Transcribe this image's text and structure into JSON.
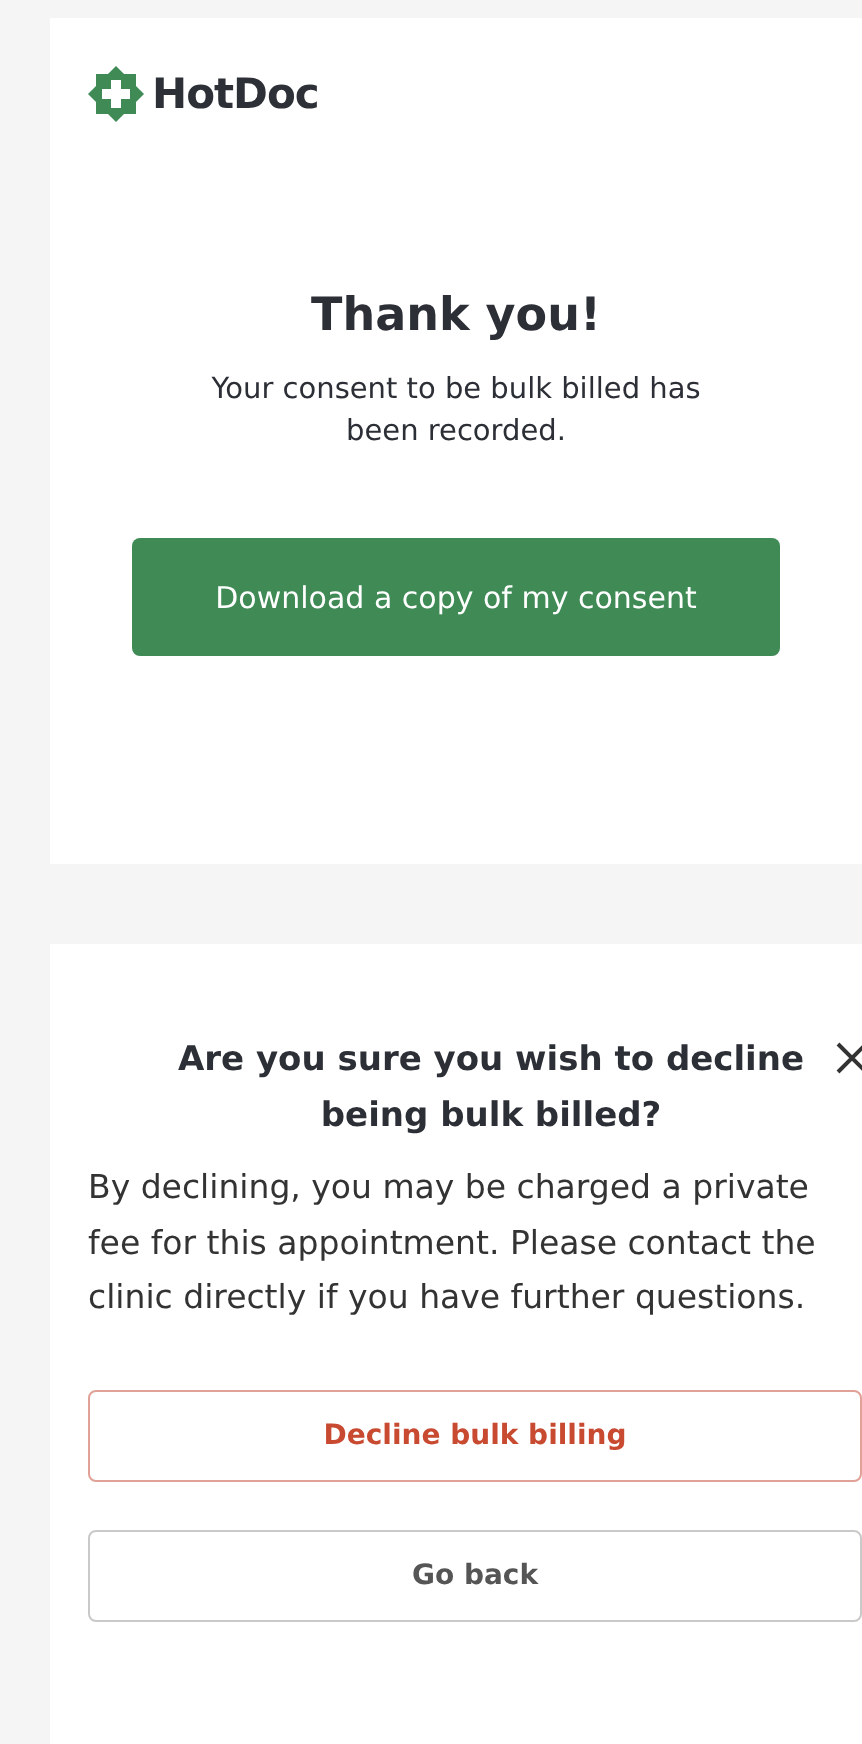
{
  "brand": {
    "name": "HotDoc"
  },
  "confirmation": {
    "title": "Thank you!",
    "message": "Your consent to be bulk billed has been recorded.",
    "button": "Download a copy of my consent"
  },
  "dialog": {
    "title": "Are you sure you wish to decline being bulk billed?",
    "body": "By declining, you may be charged a private fee for this appointment. Please contact the clinic directly if you have further questions.",
    "buttons": [
      {
        "label": "Decline bulk billing",
        "kind": "danger"
      },
      {
        "label": "Go back",
        "kind": "secondary"
      }
    ]
  }
}
